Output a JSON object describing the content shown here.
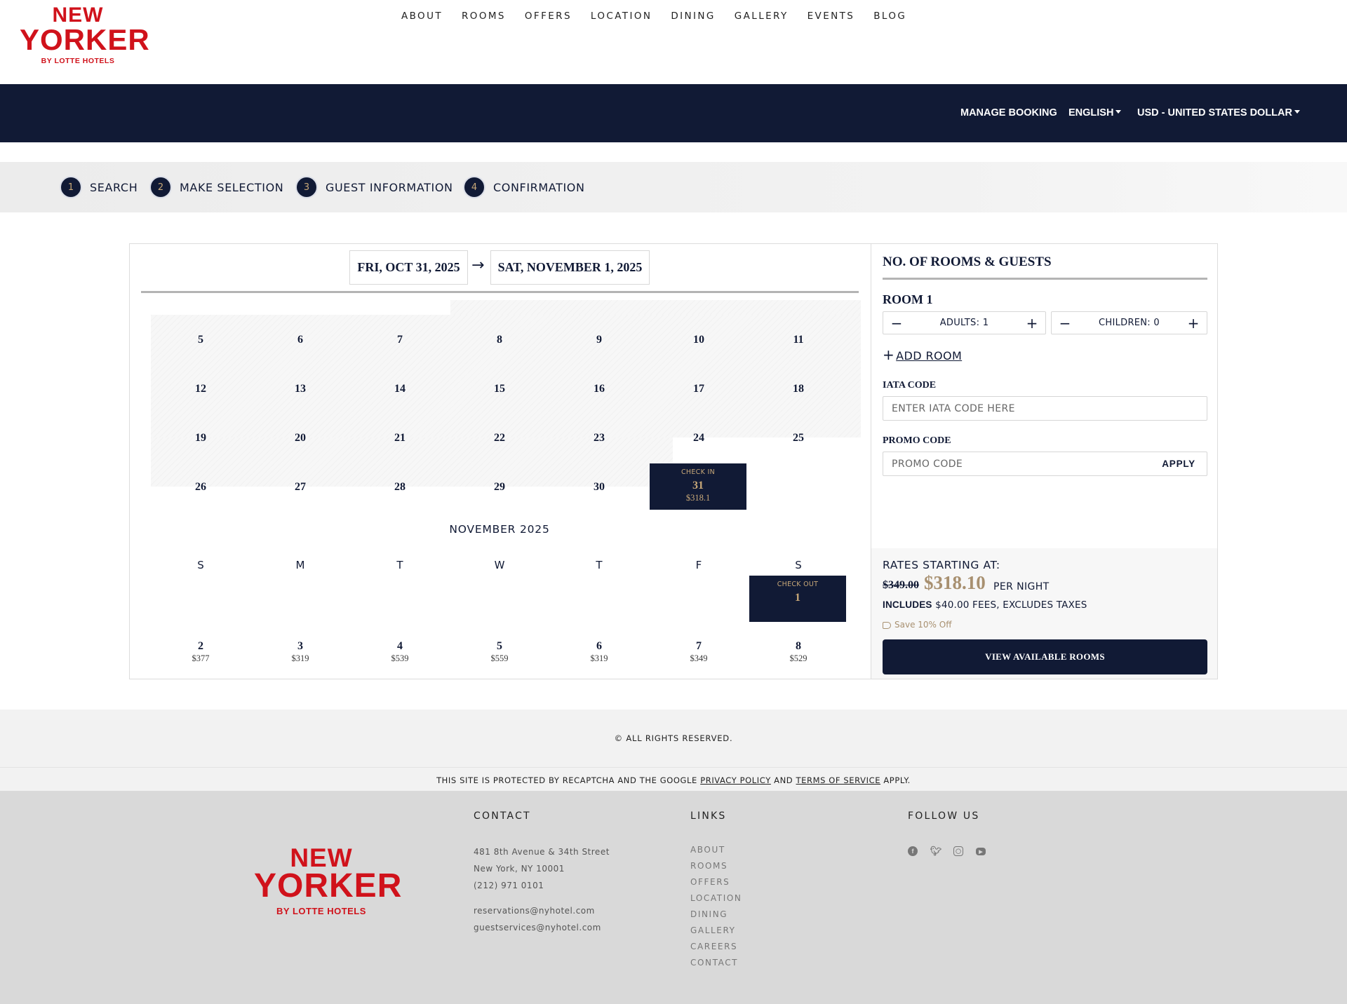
{
  "brand": {
    "logo_line1": "NEW",
    "logo_line2": "YORKER",
    "logo_line3": "BY LOTTE HOTELS",
    "colors": {
      "brand_red": "#d0121b",
      "navy": "#111a35",
      "gold": "#a89070"
    }
  },
  "nav": {
    "items": [
      {
        "label": "ABOUT"
      },
      {
        "label": "ROOMS"
      },
      {
        "label": "OFFERS"
      },
      {
        "label": "LOCATION"
      },
      {
        "label": "DINING"
      },
      {
        "label": "GALLERY"
      },
      {
        "label": "EVENTS"
      },
      {
        "label": "BLOG"
      }
    ]
  },
  "utility": {
    "manage_booking": "MANAGE BOOKING",
    "language": "ENGLISH",
    "currency": "USD - UNITED STATES DOLLAR"
  },
  "steps": [
    {
      "num": "1",
      "label": "SEARCH"
    },
    {
      "num": "2",
      "label": "MAKE SELECTION"
    },
    {
      "num": "3",
      "label": "GUEST INFORMATION"
    },
    {
      "num": "4",
      "label": "CONFIRMATION"
    }
  ],
  "dates": {
    "check_in": "FRI, OCT 31, 2025",
    "check_out": "SAT, NOVEMBER 1, 2025",
    "arrow": "→"
  },
  "october": {
    "weeks": [
      [
        "5",
        "6",
        "7",
        "8",
        "9",
        "10",
        "11"
      ],
      [
        "12",
        "13",
        "14",
        "15",
        "16",
        "17",
        "18"
      ],
      [
        "19",
        "20",
        "21",
        "22",
        "23",
        "24",
        "25"
      ],
      [
        "26",
        "27",
        "28",
        "29",
        "30"
      ]
    ],
    "check_in_cell": {
      "caption": "CHECK IN",
      "day": "31",
      "price": "$318.1"
    }
  },
  "november": {
    "title": "NOVEMBER 2025",
    "weekdays": [
      "S",
      "M",
      "T",
      "W",
      "T",
      "F",
      "S"
    ],
    "check_out_cell": {
      "caption": "CHECK OUT",
      "day": "1"
    },
    "week2": [
      {
        "day": "2",
        "price": "$377"
      },
      {
        "day": "3",
        "price": "$319"
      },
      {
        "day": "4",
        "price": "$539"
      },
      {
        "day": "5",
        "price": "$559"
      },
      {
        "day": "6",
        "price": "$319"
      },
      {
        "day": "7",
        "price": "$349"
      },
      {
        "day": "8",
        "price": "$529"
      }
    ]
  },
  "sidebar": {
    "title": "NO. OF ROOMS & GUESTS",
    "room_title": "ROOM 1",
    "adults": "ADULTS: 1",
    "children": "CHILDREN: 0",
    "minus": "−",
    "plus": "+",
    "add_room": "ADD ROOM",
    "iata_label": "IATA CODE",
    "iata_placeholder": "ENTER IATA CODE HERE",
    "promo_label": "PROMO CODE",
    "promo_placeholder": "PROMO CODE",
    "apply": "APPLY",
    "rates_label": "RATES STARTING AT:",
    "old_price": "$349.00",
    "new_price": "$318.10",
    "per_night": "PER NIGHT",
    "includes_bold": "INCLUDES",
    "includes_fee": "$40.00",
    "includes_rest": "FEES, EXCLUDES TAXES",
    "save": "Save 10% Off",
    "view_rooms": "VIEW AVAILABLE ROOMS"
  },
  "footer": {
    "copyright": "© ALL RIGHTS RESERVED.",
    "recaptcha_pre": "THIS SITE IS PROTECTED BY RECAPTCHA AND THE GOOGLE",
    "privacy": "PRIVACY POLICY",
    "and": "AND",
    "terms": "TERMS OF SERVICE",
    "apply": "APPLY.",
    "contact_head": "CONTACT",
    "address1": "481 8th Avenue & 34th Street",
    "address2": "New York, NY 10001",
    "phone": "(212) 971 0101",
    "email1": "reservations@nyhotel.com",
    "email2": "guestservices@nyhotel.com",
    "links_head": "LINKS",
    "links": [
      "ABOUT",
      "ROOMS",
      "OFFERS",
      "LOCATION",
      "DINING",
      "GALLERY",
      "CAREERS",
      "CONTACT"
    ],
    "follow_head": "FOLLOW US",
    "social": [
      "facebook-icon",
      "twitter-icon",
      "instagram-icon",
      "youtube-icon"
    ]
  }
}
